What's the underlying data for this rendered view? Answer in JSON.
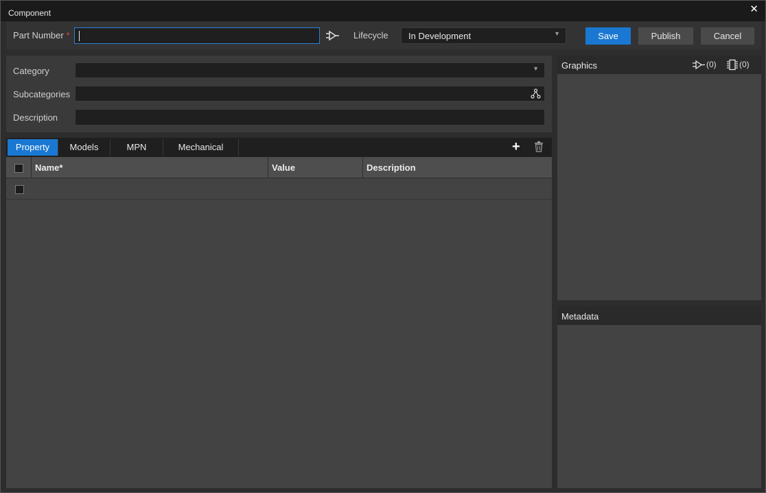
{
  "window": {
    "title": "Component",
    "close_glyph": "✕"
  },
  "toolbar": {
    "part_number_label": "Part Number",
    "required_mark": "*",
    "part_number_value": "",
    "symbol_button_icon": "symbol-icon",
    "lifecycle_label": "Lifecycle",
    "lifecycle_value": "In Development",
    "save_label": "Save",
    "publish_label": "Publish",
    "cancel_label": "Cancel"
  },
  "form": {
    "category_label": "Category",
    "category_value": "",
    "subcategories_label": "Subcategories",
    "subcategories_value": "",
    "description_label": "Description",
    "description_value": ""
  },
  "tabs": [
    {
      "label": "Property",
      "active": true
    },
    {
      "label": "Models",
      "active": false
    },
    {
      "label": "MPN",
      "active": false
    },
    {
      "label": "Mechanical",
      "active": false
    }
  ],
  "table": {
    "columns": [
      "Name*",
      "Value",
      "Description"
    ],
    "rows": [
      {
        "name": "",
        "value": "",
        "description": ""
      }
    ]
  },
  "graphics": {
    "title": "Graphics",
    "symbol_count": "(0)",
    "footprint_count": "(0)"
  },
  "metadata": {
    "title": "Metadata"
  },
  "colors": {
    "accent": "#1a78d2",
    "required": "#e04040",
    "background": "#2d2d2d"
  }
}
